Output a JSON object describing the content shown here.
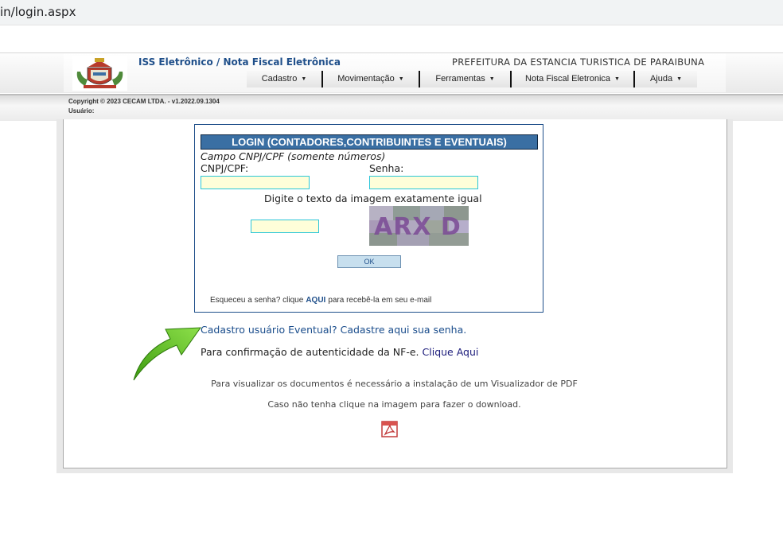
{
  "browser": {
    "url": "in/login.aspx"
  },
  "header": {
    "app_title": "ISS Eletrônico / Nota Fiscal Eletrônica",
    "prefeitura": "PREFEITURA DA ESTANCIA TURISTICA DE PARAIBUNA",
    "menu": [
      {
        "label": "Cadastro"
      },
      {
        "label": "Movimentação"
      },
      {
        "label": "Ferramentas"
      },
      {
        "label": "Nota Fiscal Eletronica"
      },
      {
        "label": "Ajuda"
      }
    ],
    "copyright": "Copyright © 2023 CECAM LTDA. - v1.2022.09.1304",
    "usuario_label": "Usuário:"
  },
  "login": {
    "title": "LOGIN (CONTADORES,CONTRIBUINTES E EVENTUAIS)",
    "hint": "Campo CNPJ/CPF (somente números)",
    "cnpj_label": "CNPJ/CPF:",
    "cnpj_value": "",
    "senha_label": "Senha:",
    "senha_value": "",
    "captcha_label": "Digite o texto da imagem exatamente igual",
    "captcha_value": "",
    "captcha_text": "ARX D",
    "ok_label": "OK",
    "forgot_prefix": "Esqueceu a senha? clique",
    "forgot_link": "AQUI",
    "forgot_suffix": "para recebê-la em seu e-mail"
  },
  "links": {
    "cadastro_eventual": "Cadastro usuário Eventual? Cadastre aqui sua senha.",
    "confirm_prefix": "Para confirmação de autenticidade da NF-e.",
    "confirm_link": "Clique Aqui"
  },
  "info": {
    "pdf_line1": "Para visualizar os documentos é necessário a instalação de um Visualizador de PDF",
    "pdf_line2": "Caso não tenha clique na imagem para fazer o download."
  },
  "colors": {
    "header_blue": "#3a6fa3",
    "link_blue": "#1a4d8c",
    "input_bg": "#fefed9",
    "input_border": "#2bc6d8",
    "arrow_green": "#5cc11e"
  },
  "icons": {
    "pdf": "pdf-download-icon",
    "arrow": "green-arrow-icon",
    "logo": "city-coat-of-arms"
  }
}
